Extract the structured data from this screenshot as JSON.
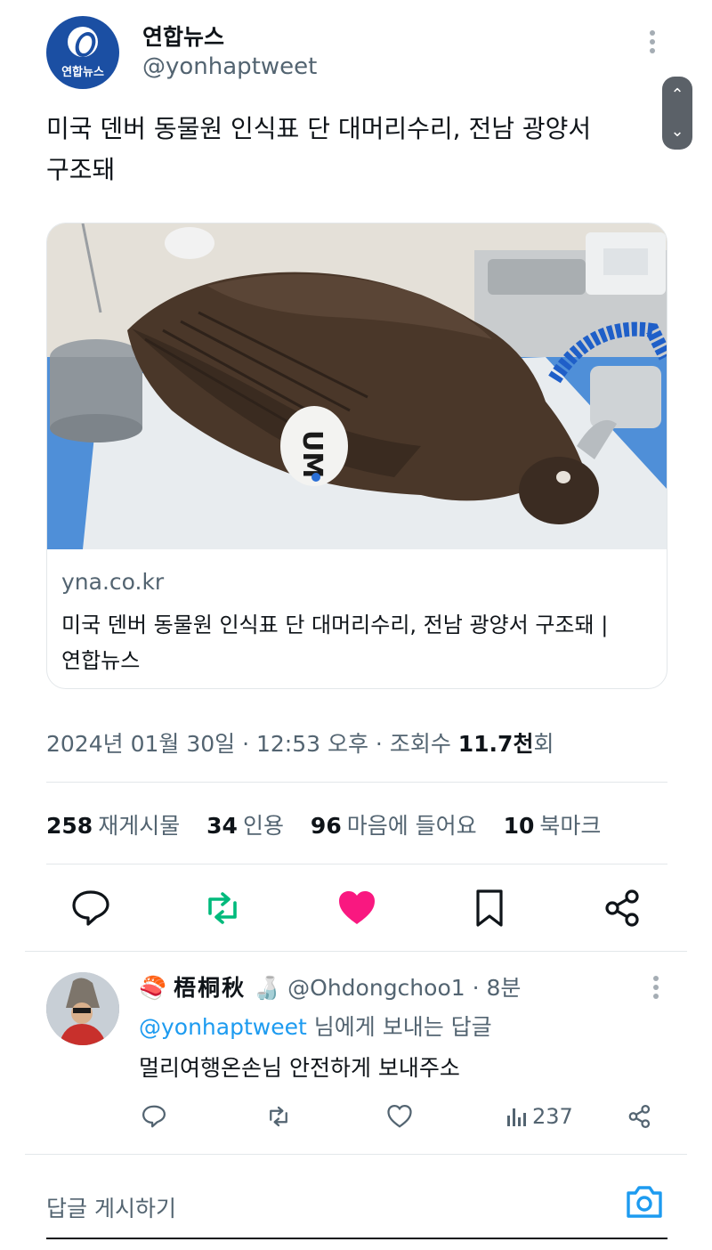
{
  "tweet": {
    "author_name": "연합뉴스",
    "author_handle": "@yonhaptweet",
    "avatar_text": "연합뉴스",
    "text_line1": "미국 덴버 동물원 인식표 단 대머리수리, 전남 광양서",
    "text_line2": "구조돼",
    "card": {
      "domain": "yna.co.kr",
      "title_line1": "미국 덴버 동물원 인식표 단 대머리수리, 전남 광양서 구조돼 |",
      "title_line2": "연합뉴스",
      "tag_text": "UM"
    },
    "timestamp": "2024년 01월 30일 · 12:53 오후 · 조회수 ",
    "views_num": "11.7천",
    "views_unit": "회",
    "stats": [
      {
        "num": "258",
        "label": "재게시물"
      },
      {
        "num": "34",
        "label": "인용"
      },
      {
        "num": "96",
        "label": "마음에 들어요"
      },
      {
        "num": "10",
        "label": "북마크"
      }
    ]
  },
  "reply": {
    "name": "梧桐秋",
    "name_emoji_left": "🍣",
    "name_emoji_right": "🍶",
    "meta": "@Ohdongchoo1 · 8분",
    "reply_mention": "@yonhaptweet",
    "reply_suffix": " 님에게 보내는 답글",
    "text": "멀리여행온손님 안전하게 보내주소",
    "views": "237"
  },
  "compose": {
    "placeholder": "답글 게시하기"
  },
  "colors": {
    "retweet": "#00ba7c",
    "like": "#f91880",
    "link": "#1d9bf0",
    "muted": "#536471"
  },
  "icons": [
    "reply-icon",
    "retweet-icon",
    "heart-icon",
    "bookmark-icon",
    "share-icon",
    "views-icon",
    "camera-icon",
    "more-icon"
  ]
}
